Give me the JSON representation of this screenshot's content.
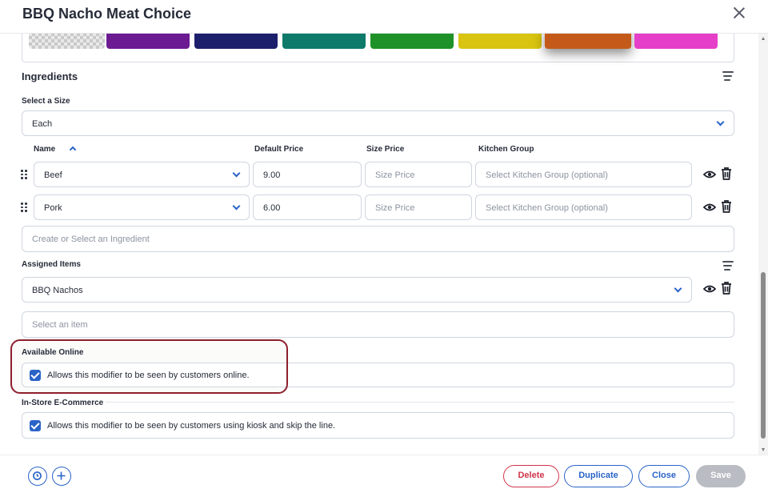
{
  "dialog": {
    "title": "BBQ Nacho Meat Choice"
  },
  "colors": {
    "accent": "#2a63c7",
    "highlight_ring": "#8e1f2d",
    "swatches": [
      "#e6e6e6",
      "#6b1a92",
      "#1c1f6b",
      "#0d7a6a",
      "#1e9128",
      "#d8c411",
      "#c45a1a",
      "#e53fc9"
    ],
    "selected_swatch": "#c45a1a",
    "delete": "#d0344a"
  },
  "ingredients": {
    "title": "Ingredients",
    "size_label": "Select a Size",
    "size_value": "Each",
    "columns": {
      "name": "Name",
      "default_price": "Default Price",
      "size_price": "Size Price",
      "kitchen_group": "Kitchen Group"
    },
    "rows": [
      {
        "name": "Beef",
        "default_price": "9.00",
        "size_price_placeholder": "Size Price",
        "kitchen_group_placeholder": "Select Kitchen Group (optional)"
      },
      {
        "name": "Pork",
        "default_price": "6.00",
        "size_price_placeholder": "Size Price",
        "kitchen_group_placeholder": "Select Kitchen Group (optional)"
      }
    ],
    "create_placeholder": "Create or Select an Ingredient"
  },
  "assigned": {
    "title": "Assigned Items",
    "item": "BBQ Nachos",
    "select_placeholder": "Select an item"
  },
  "online": {
    "label": "Available Online",
    "checked": true,
    "text": "Allows this modifier to be seen by customers online."
  },
  "instore": {
    "label": "In-Store E-Commerce",
    "checked": true,
    "text": "Allows this modifier to be seen by customers using kiosk and skip the line."
  },
  "footer": {
    "delete": "Delete",
    "duplicate": "Duplicate",
    "close": "Close",
    "save": "Save"
  }
}
